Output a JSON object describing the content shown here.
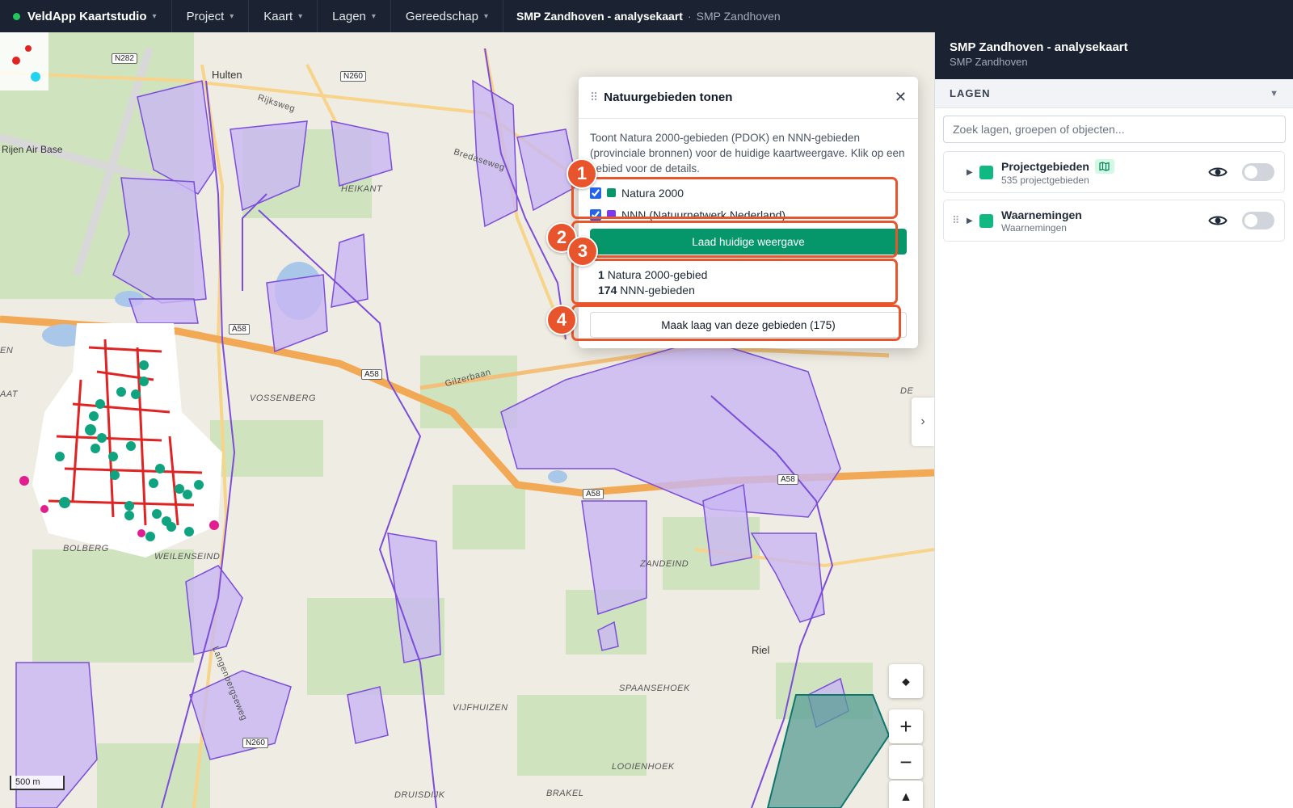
{
  "topbar": {
    "app_name": "VeldApp Kaartstudio",
    "menus": [
      "Project",
      "Kaart",
      "Lagen",
      "Gereedschap"
    ],
    "map_title": "SMP Zandhoven - analysekaart",
    "separator": "·",
    "project_name": "SMP Zandhoven"
  },
  "map": {
    "place_labels": {
      "hulten": "Hulten",
      "rijen": "Rijen Air Base",
      "heikant": "HEIKANT",
      "vossenberg": "VOSSENBERG",
      "bolberg": "BOLBERG",
      "weilenseind": "WEILENSEIND",
      "zandeind": "ZANDEIND",
      "riel": "Riel",
      "spaansehoek": "SPAANSEHOEK",
      "vijfhuizen": "VIJFHUIZEN",
      "looienhoek": "LOOIENHOEK",
      "druisdijk": "DRUISDIJK",
      "brakel": "BRAKEL",
      "rijksweg": "Rijksweg",
      "bredaseweg": "Bredaseweg",
      "gilzerbaan": "Gilzerbaan",
      "langenbergseweg": "Langenbergseweg",
      "en": "EN",
      "aat": "AAT",
      "de": "DE"
    },
    "road_shields": {
      "n282": "N282",
      "n260a": "N260",
      "n260b": "N260",
      "a58a": "A58",
      "a58b": "A58",
      "a58c": "A58",
      "a58d": "A58"
    },
    "scale": "500 m",
    "colors": {
      "nnn_fill": "#c8b6f2",
      "nnn_stroke": "#7c4ddb",
      "natura_fill": "#5a9e96",
      "natura_stroke": "#0f766e"
    }
  },
  "popup": {
    "title": "Natuurgebieden tonen",
    "description": "Toont Natura 2000-gebieden (PDOK) en NNN-gebieden (provinciale bronnen) voor de huidige kaartweergave. Klik op een gebied voor de details.",
    "checkboxes": [
      {
        "label": "Natura 2000",
        "color": "#059669",
        "checked": true
      },
      {
        "label": "NNN (Natuurnetwerk Nederland)",
        "color": "#7c3aed",
        "checked": true
      }
    ],
    "load_button": "Laad huidige weergave",
    "results": [
      {
        "count": "1",
        "label": "Natura 2000-gebied"
      },
      {
        "count": "174",
        "label": "NNN-gebieden"
      }
    ],
    "make_layer_button": "Maak laag van deze gebieden (175)",
    "badges": [
      "1",
      "2",
      "3",
      "4"
    ],
    "accent": "#e8542b"
  },
  "panel": {
    "title": "SMP Zandhoven - analysekaart",
    "subtitle": "SMP Zandhoven",
    "section": "LAGEN",
    "search_placeholder": "Zoek lagen, groepen of objecten...",
    "layers": [
      {
        "name": "Projectgebieden",
        "count": "535 projectgebieden",
        "color": "#10b981"
      },
      {
        "name": "Waarnemingen",
        "count": "Waarnemingen",
        "color": "#10b981"
      }
    ]
  }
}
